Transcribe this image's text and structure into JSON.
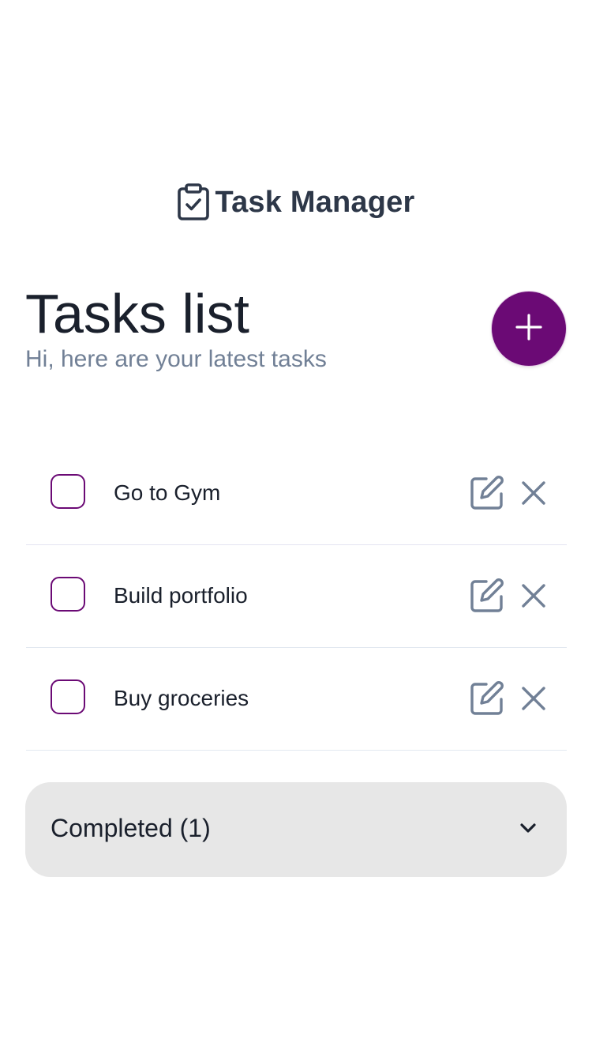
{
  "app": {
    "title": "Task Manager",
    "logo_icon": "clipboard-check-icon"
  },
  "header": {
    "title": "Tasks list",
    "subtitle": "Hi, here are your latest tasks"
  },
  "add_button": {
    "icon": "plus-icon"
  },
  "tasks": [
    {
      "label": "Go to Gym",
      "checked": false
    },
    {
      "label": "Build portfolio",
      "checked": false
    },
    {
      "label": "Buy groceries",
      "checked": false
    }
  ],
  "completed": {
    "label": "Completed (1)",
    "icon": "chevron-down-icon"
  },
  "colors": {
    "accent": "#6b0a75",
    "icon_gray": "#718096",
    "text": "#1a202c",
    "panel_bg": "#e7e7e7"
  }
}
